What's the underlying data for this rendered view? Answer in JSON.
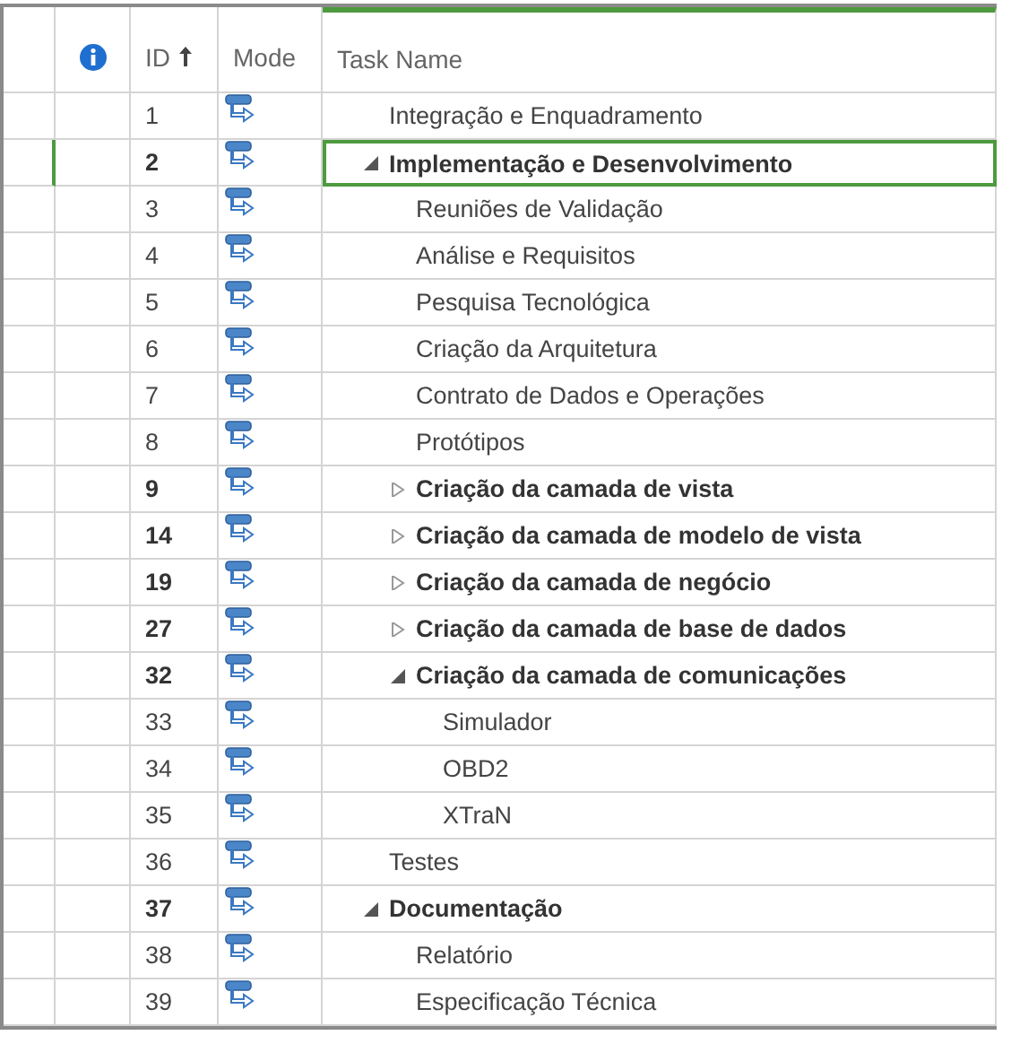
{
  "table": {
    "columns": [
      {
        "kind": "info",
        "selected": false,
        "sorted": false
      },
      {
        "kind": "text",
        "label": "ID",
        "selected": false,
        "sorted": true
      },
      {
        "kind": "text",
        "label": "Mode",
        "selected": false,
        "sorted": false
      },
      {
        "kind": "text",
        "label": "Task Name",
        "selected": true,
        "sorted": false
      }
    ],
    "rows": [
      {
        "id": "1",
        "kind": "task",
        "name": "Integração e Enquadramento",
        "selected": false
      },
      {
        "id": "2",
        "kind": "summary",
        "name": "Implementação e Desenvolvimento",
        "selected": true,
        "expanded": true,
        "children": [
          {
            "id": "3",
            "kind": "task",
            "name": "Reuniões de Validação",
            "selected": false
          },
          {
            "id": "4",
            "kind": "task",
            "name": "Análise e Requisitos",
            "selected": false
          },
          {
            "id": "5",
            "kind": "task",
            "name": "Pesquisa Tecnológica",
            "selected": false
          },
          {
            "id": "6",
            "kind": "task",
            "name": "Criação da Arquitetura",
            "selected": false
          },
          {
            "id": "7",
            "kind": "task",
            "name": "Contrato de Dados e Operações",
            "selected": false
          },
          {
            "id": "8",
            "kind": "task",
            "name": "Protótipos",
            "selected": false
          },
          {
            "id": "9",
            "kind": "summary",
            "name": "Criação da camada de vista",
            "selected": false,
            "expanded": false
          },
          {
            "id": "14",
            "kind": "summary",
            "name": "Criação da camada de modelo de vista",
            "selected": false,
            "expanded": false
          },
          {
            "id": "19",
            "kind": "summary",
            "name": "Criação da camada de negócio",
            "selected": false,
            "expanded": false
          },
          {
            "id": "27",
            "kind": "summary",
            "name": "Criação da camada de base de dados",
            "selected": false,
            "expanded": false
          },
          {
            "id": "32",
            "kind": "summary",
            "name": "Criação da camada de comunicações",
            "selected": false,
            "expanded": true,
            "children": [
              {
                "id": "33",
                "kind": "task",
                "name": "Simulador",
                "selected": false
              },
              {
                "id": "34",
                "kind": "task",
                "name": "OBD2",
                "selected": false
              },
              {
                "id": "35",
                "kind": "task",
                "name": "XTraN",
                "selected": false
              }
            ]
          }
        ]
      },
      {
        "id": "36",
        "kind": "task",
        "name": "Testes",
        "selected": false
      },
      {
        "id": "37",
        "kind": "summary",
        "name": "Documentação",
        "selected": false,
        "expanded": true,
        "children": [
          {
            "id": "38",
            "kind": "task",
            "name": "Relatório",
            "selected": false
          },
          {
            "id": "39",
            "kind": "task",
            "name": "Especificação Técnica",
            "selected": false
          }
        ]
      }
    ]
  }
}
